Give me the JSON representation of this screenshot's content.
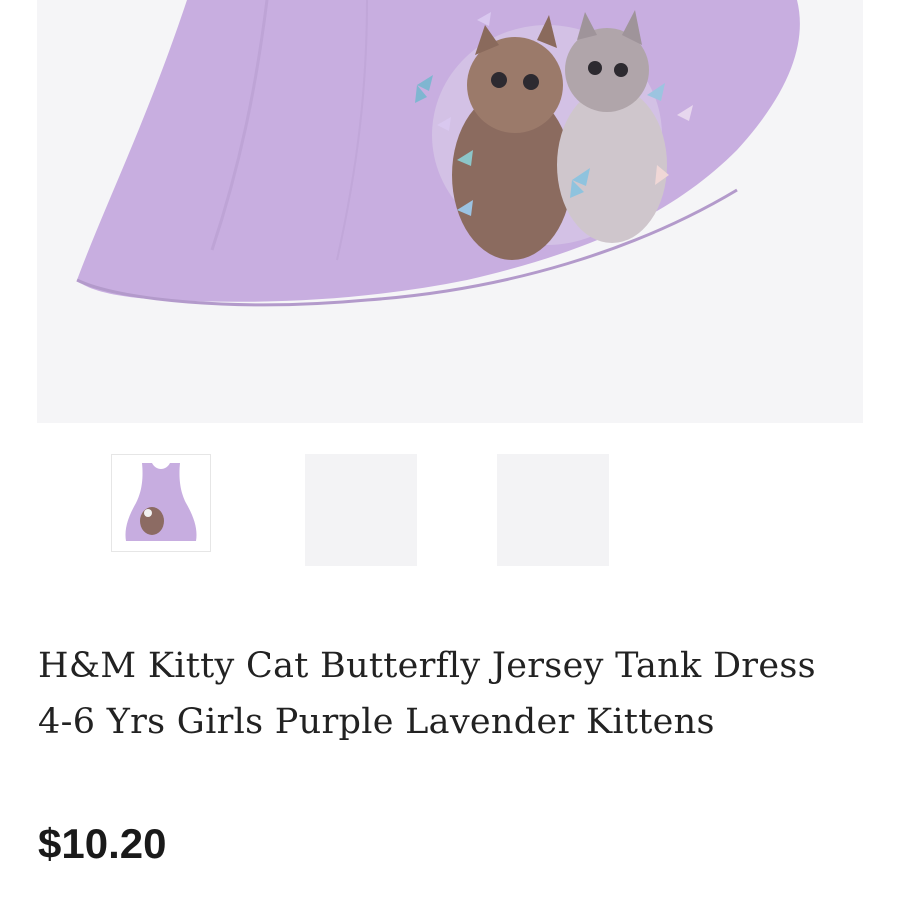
{
  "product": {
    "title": "H&M Kitty Cat Butterfly Jersey Tank Dress 4-6 Yrs Girls Purple Lavender Kittens",
    "price": "$10.20"
  },
  "gallery": {
    "thumbnail_count": 3,
    "selected_index": 0
  },
  "colors": {
    "dress": "#c8aee0",
    "background": "#ffffff"
  }
}
